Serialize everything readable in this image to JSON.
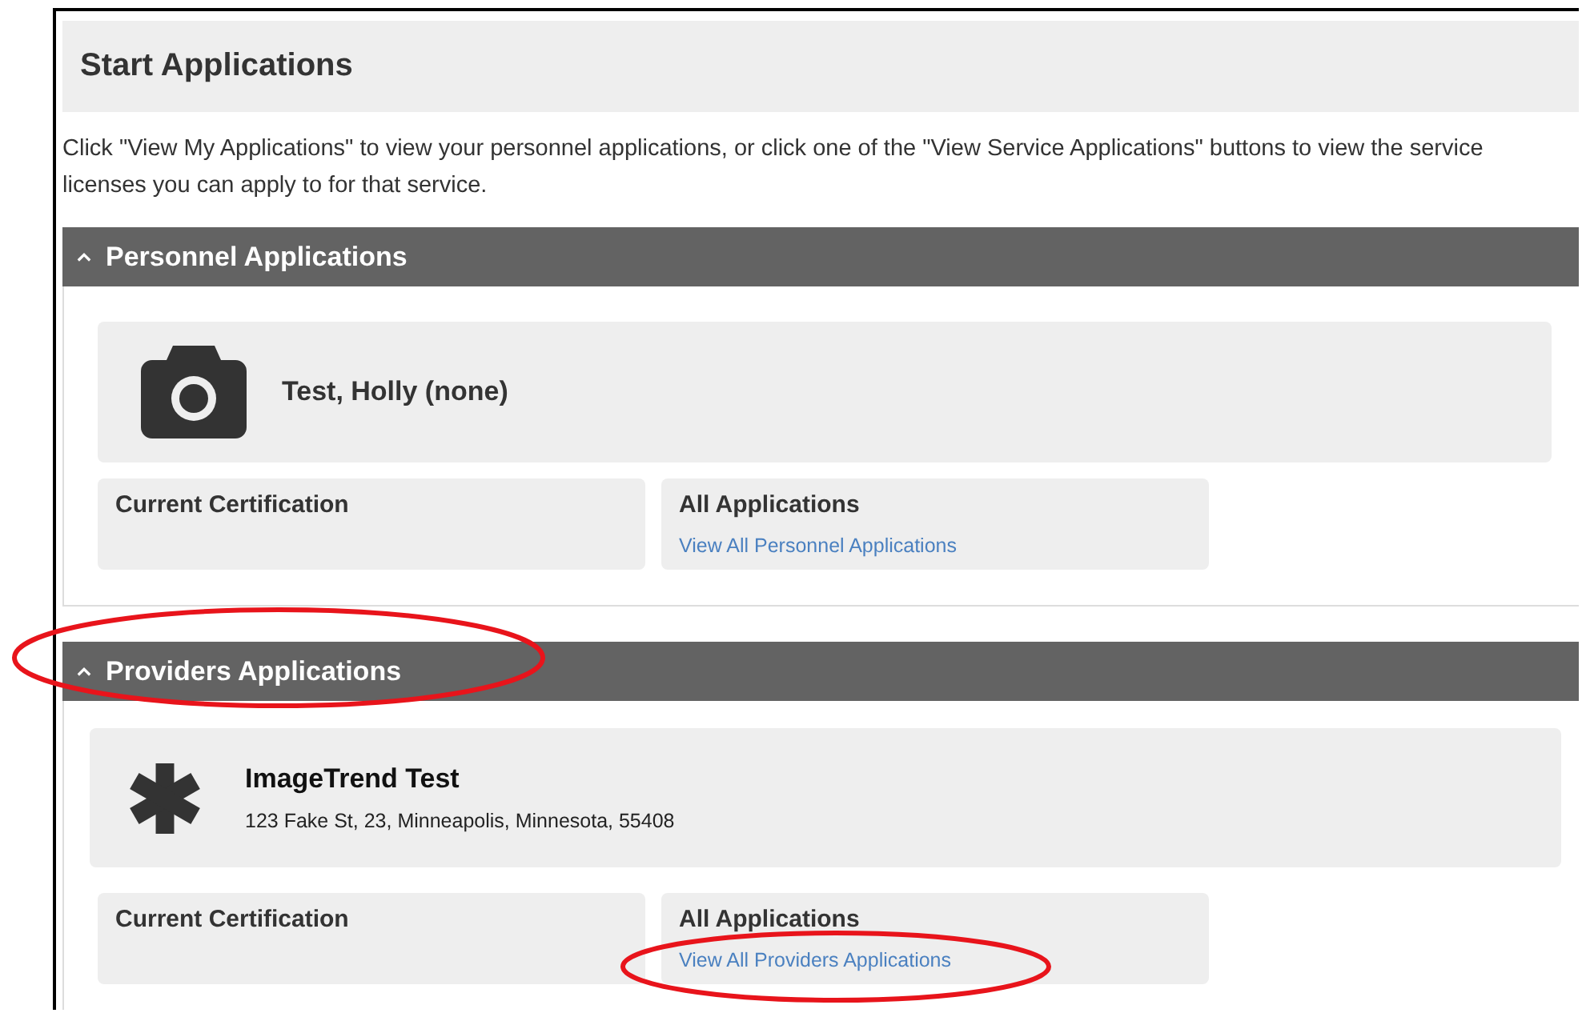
{
  "page_title": "Start Applications",
  "intro": "Click \"View My Applications\" to view your personnel applications, or click one of the \"View Service Applications\" buttons to view the service licenses you can apply to for that service.",
  "sections": [
    {
      "title": "Personnel Applications",
      "expanded": true,
      "entity": {
        "kind": "person",
        "name": "Test, Holly (none)"
      },
      "panels": [
        {
          "title": "Current Certification"
        },
        {
          "title": "All Applications",
          "link": "View All Personnel Applications"
        }
      ]
    },
    {
      "title": "Providers Applications",
      "expanded": true,
      "entity": {
        "kind": "organization",
        "name": "ImageTrend Test",
        "address": "123 Fake St, 23, Minneapolis, Minnesota, 55408"
      },
      "panels": [
        {
          "title": "Current Certification"
        },
        {
          "title": "All Applications",
          "link": "View All Providers Applications"
        }
      ]
    }
  ]
}
